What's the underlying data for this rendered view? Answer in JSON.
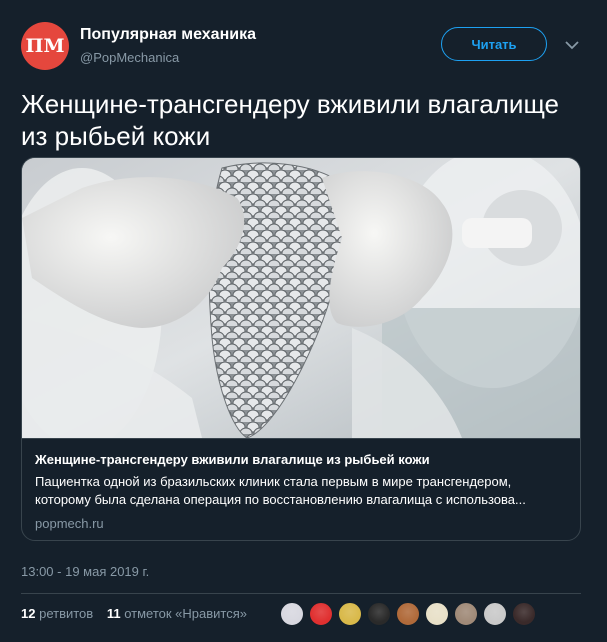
{
  "account": {
    "avatar_text": "ПМ",
    "name": "Популярная механика",
    "handle": "@PopMechanica",
    "follow_label": "Читать",
    "brand_color": "#e5473d",
    "accent_color": "#1da1f2"
  },
  "tweet": {
    "text": "Женщине-трансгендеру вживили влагалище из рыбьей кожи",
    "timestamp": "13:00 - 19 мая 2019 г."
  },
  "card": {
    "image_alt": "fish-skin-graft-photo",
    "title": "Женщине-трансгендеру вживили влагалище из рыбьей кожи",
    "description_line1": "Пациентка одной из бразильских клиник стала первым в мире трансгендером,",
    "description_line2": "которому была сделана операция по восстановлению влагалища с использова...",
    "domain": "popmech.ru"
  },
  "stats": {
    "retweets_count": "12",
    "retweets_label": "ретвитов",
    "likes_count": "11",
    "likes_label": "отметок «Нравится»"
  },
  "likers": [
    {
      "icon": "avatar-1-icon",
      "color": "#d8d8e0"
    },
    {
      "icon": "avatar-2-icon",
      "color": "#e03030"
    },
    {
      "icon": "avatar-3-icon",
      "color": "#d9b94a"
    },
    {
      "icon": "avatar-4-icon",
      "color": "#2a2a2a"
    },
    {
      "icon": "avatar-5-icon",
      "color": "#b06a3a"
    },
    {
      "icon": "avatar-6-icon",
      "color": "#e8e0c8"
    },
    {
      "icon": "avatar-7-icon",
      "color": "#a08a78"
    },
    {
      "icon": "avatar-8-icon",
      "color": "#c9c9c9"
    },
    {
      "icon": "avatar-9-icon",
      "color": "#3a2a2a"
    }
  ]
}
